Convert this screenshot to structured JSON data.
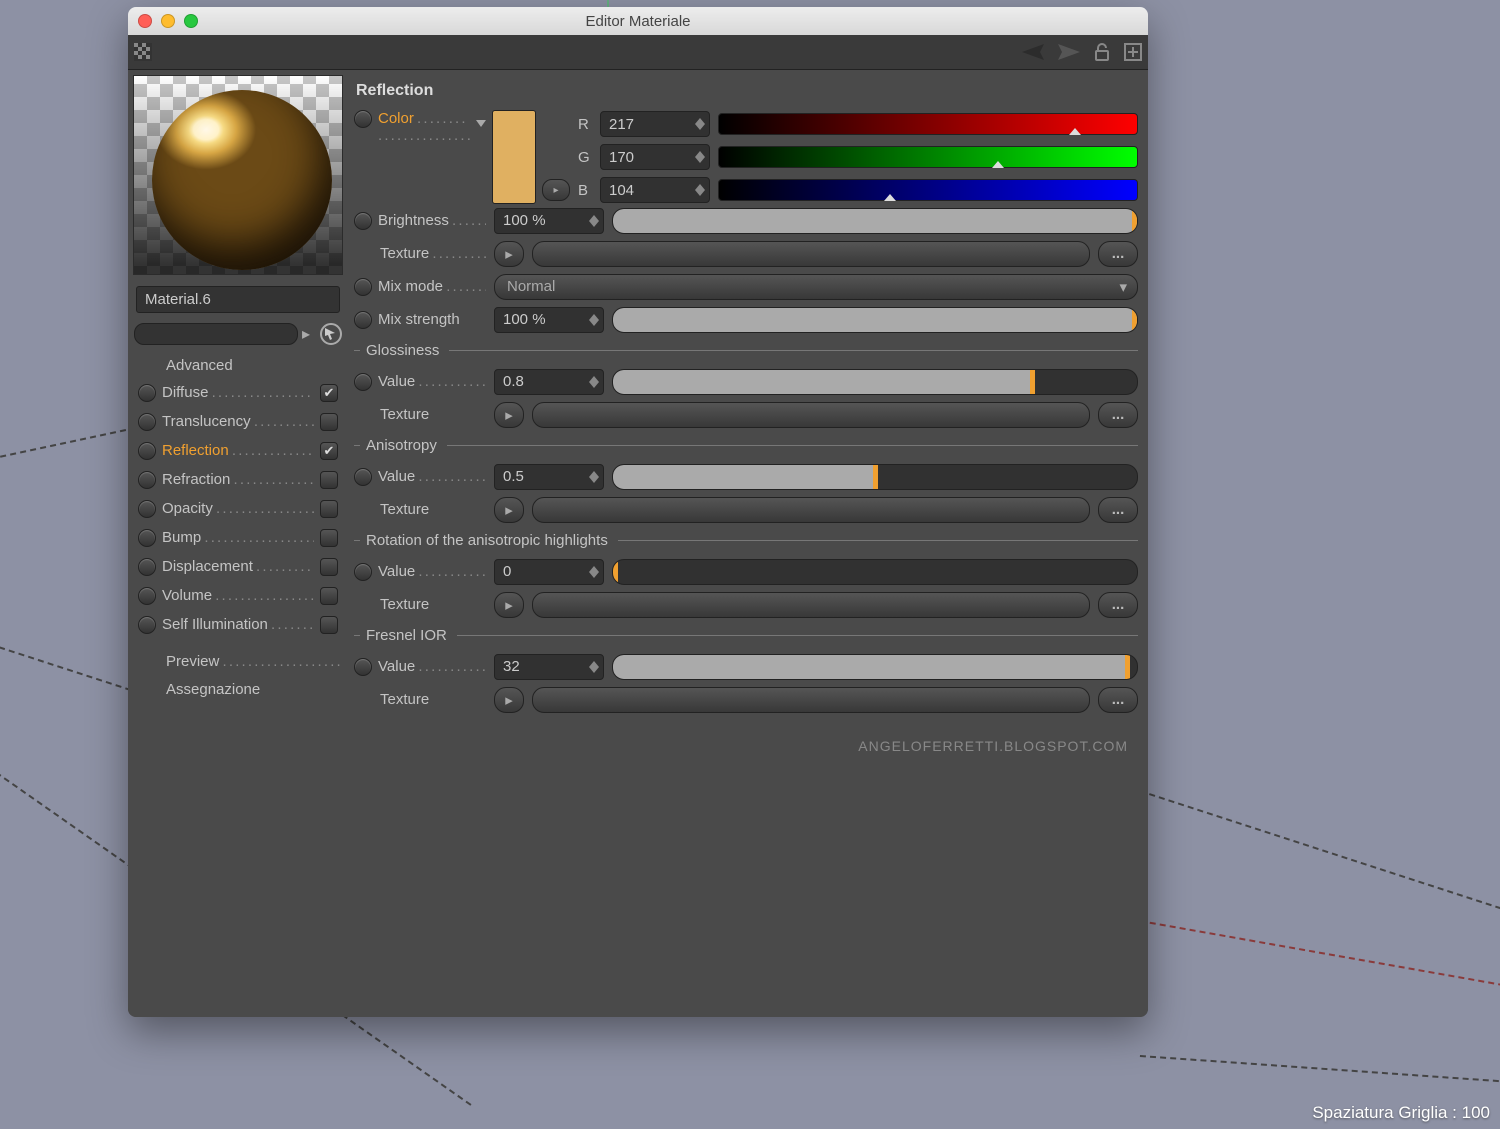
{
  "window": {
    "title": "Editor Materiale"
  },
  "material_name": "Material.6",
  "sidebar": {
    "advanced_label": "Advanced",
    "channels": [
      {
        "label": "Diffuse",
        "checked": true,
        "active": false
      },
      {
        "label": "Translucency",
        "checked": false,
        "active": false
      },
      {
        "label": "Reflection",
        "checked": true,
        "active": true
      },
      {
        "label": "Refraction",
        "checked": false,
        "active": false
      },
      {
        "label": "Opacity",
        "checked": false,
        "active": false
      },
      {
        "label": "Bump",
        "checked": false,
        "active": false
      },
      {
        "label": "Displacement",
        "checked": false,
        "active": false
      },
      {
        "label": "Volume",
        "checked": false,
        "active": false
      },
      {
        "label": "Self Illumination",
        "checked": false,
        "active": false
      }
    ],
    "preview_label": "Preview",
    "assign_label": "Assegnazione"
  },
  "panel": {
    "title": "Reflection",
    "color": {
      "label": "Color",
      "swatch_hex": "#e0b061",
      "r_label": "R",
      "r_value": "217",
      "r_pct": 85.1,
      "g_label": "G",
      "g_value": "170",
      "g_pct": 66.7,
      "b_label": "B",
      "b_value": "104",
      "b_pct": 40.8
    },
    "brightness": {
      "label": "Brightness",
      "value": "100 %",
      "fill": 100
    },
    "texture_label": "Texture",
    "browse_label": "...",
    "mixmode": {
      "label": "Mix mode",
      "value": "Normal"
    },
    "mixstrength": {
      "label": "Mix strength",
      "value": "100 %",
      "fill": 100
    },
    "glossiness": {
      "title": "Glossiness",
      "value_label": "Value",
      "value": "0.8",
      "fill": 80
    },
    "anisotropy": {
      "title": "Anisotropy",
      "value_label": "Value",
      "value": "0.5",
      "fill": 50
    },
    "rotation": {
      "title": "Rotation of the anisotropic highlights",
      "value_label": "Value",
      "value": "0",
      "fill": 0
    },
    "fresnel": {
      "title": "Fresnel IOR",
      "value_label": "Value",
      "value": "32",
      "fill": 98
    }
  },
  "credit": "ANGELOFERRETTI.BLOGSPOT.COM",
  "statusbar": {
    "label": "Spaziatura Griglia",
    "value": "100"
  }
}
